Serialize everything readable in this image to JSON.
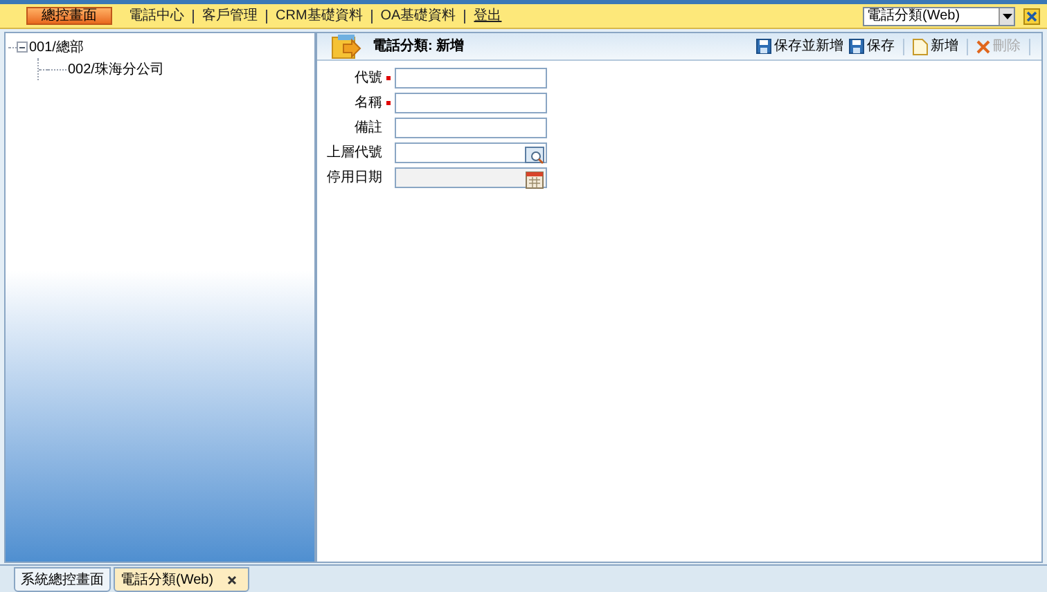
{
  "menu": {
    "home": "總控畫面",
    "items": [
      "電話中心",
      "客戶管理",
      "CRM基礎資料",
      "OA基礎資料"
    ],
    "logout": "登出",
    "module_select": "電話分類(Web)"
  },
  "tree": [
    {
      "label": "001/總部",
      "expanded": true,
      "children": [
        {
          "label": "002/珠海分公司"
        }
      ]
    }
  ],
  "form": {
    "title": "電話分類: 新增",
    "toolbar": [
      {
        "label": "保存並新增",
        "kind": "save-new",
        "disabled": false
      },
      {
        "label": "保存",
        "kind": "save",
        "disabled": false
      },
      {
        "label": "新增",
        "kind": "new",
        "disabled": false
      },
      {
        "label": "刪除",
        "kind": "delete",
        "disabled": true
      }
    ],
    "fields": [
      {
        "label": "代號",
        "required": true,
        "kind": "text"
      },
      {
        "label": "名稱",
        "required": true,
        "kind": "text"
      },
      {
        "label": "備註",
        "required": false,
        "kind": "text"
      },
      {
        "label": "上層代號",
        "required": false,
        "kind": "lookup"
      },
      {
        "label": "停用日期",
        "required": false,
        "kind": "date"
      }
    ]
  },
  "tabs": [
    {
      "label": "系統總控畫面",
      "selected": false,
      "closable": false
    },
    {
      "label": "電話分類(Web)",
      "selected": true,
      "closable": true
    }
  ]
}
